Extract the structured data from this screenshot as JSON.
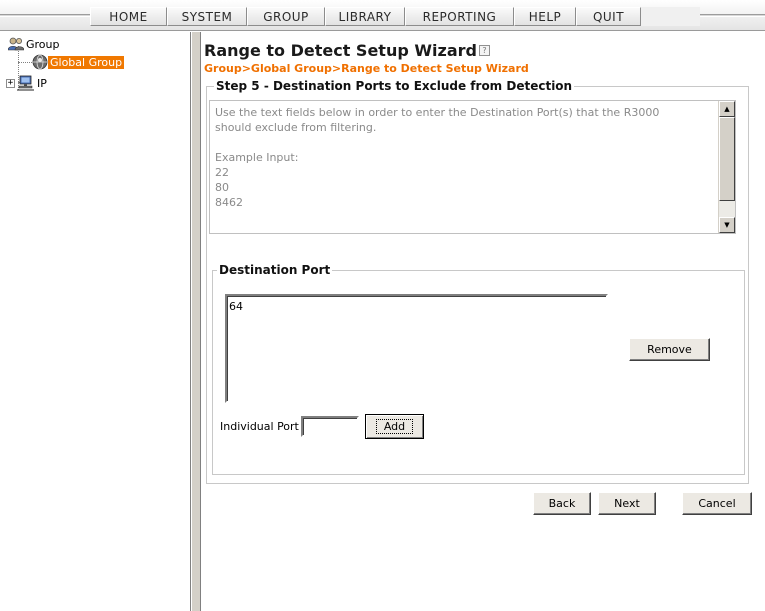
{
  "nav": {
    "items": [
      "HOME",
      "SYSTEM",
      "GROUP",
      "LIBRARY",
      "REPORTING",
      "HELP",
      "QUIT"
    ]
  },
  "tree": {
    "root": {
      "label": "Group",
      "icon": "group-icon"
    },
    "selected": {
      "label": "Global Group",
      "icon": "globe-icon"
    },
    "ip": {
      "label": "IP",
      "icon": "network-computer-icon",
      "expander": "+"
    }
  },
  "colors": {
    "accent": "#f07000",
    "selection": "#f07800"
  },
  "page": {
    "title": "Range to Detect Setup Wizard",
    "help_glyph": "?",
    "breadcrumb": "Group>Global Group>Range to Detect Setup Wizard"
  },
  "step": {
    "legend": "Step 5 - Destination Ports to Exclude from Detection",
    "info_text": "Use the text fields below in order to enter the Destination Port(s) that the R3000\nshould exclude from filtering.\n\n     Example Input:\n     22\n     80\n     8462"
  },
  "dest": {
    "legend": "Destination Port",
    "ports": [
      "64"
    ],
    "remove_label": "Remove",
    "individual_label": "Individual Port",
    "individual_value": "",
    "add_label": "Add"
  },
  "footer": {
    "back_label": "Back",
    "next_label": "Next",
    "cancel_label": "Cancel"
  }
}
